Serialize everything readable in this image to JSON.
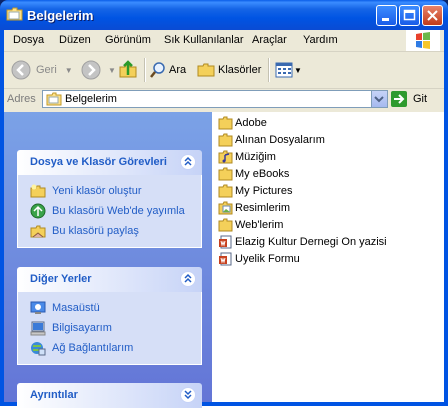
{
  "window": {
    "title": "Belgelerim"
  },
  "menu": [
    {
      "label": "Dosya"
    },
    {
      "label": "Düzen"
    },
    {
      "label": "Görünüm"
    },
    {
      "label": "Sık Kullanılanlar"
    },
    {
      "label": "Araçlar"
    },
    {
      "label": "Yardım"
    }
  ],
  "toolbar": {
    "back": "Geri",
    "search": "Ara",
    "folders": "Klasörler"
  },
  "address": {
    "label": "Adres",
    "value": "Belgelerim",
    "go": "Git"
  },
  "panels": {
    "tasks": {
      "title": "Dosya ve Klasör Görevleri",
      "items": [
        {
          "label": "Yeni klasör oluştur"
        },
        {
          "label": "Bu klasörü Web'de yayımla"
        },
        {
          "label": "Bu klasörü paylaş"
        }
      ]
    },
    "other": {
      "title": "Diğer Yerler",
      "items": [
        {
          "label": "Masaüstü"
        },
        {
          "label": "Bilgisayarım"
        },
        {
          "label": "Ağ Bağlantılarım"
        }
      ]
    },
    "details": {
      "title": "Ayrıntılar"
    }
  },
  "files": [
    {
      "name": "Adobe",
      "type": "folder"
    },
    {
      "name": "Alınan Dosyalarım",
      "type": "folder"
    },
    {
      "name": "Müziğim",
      "type": "folder"
    },
    {
      "name": "My eBooks",
      "type": "folder"
    },
    {
      "name": "My Pictures",
      "type": "folder"
    },
    {
      "name": "Resimlerim",
      "type": "folder"
    },
    {
      "name": "Web'lerim",
      "type": "folder"
    },
    {
      "name": "Elazig Kultur Dernegi On yazisi",
      "type": "document"
    },
    {
      "name": "Uyelik Formu",
      "type": "document"
    }
  ]
}
